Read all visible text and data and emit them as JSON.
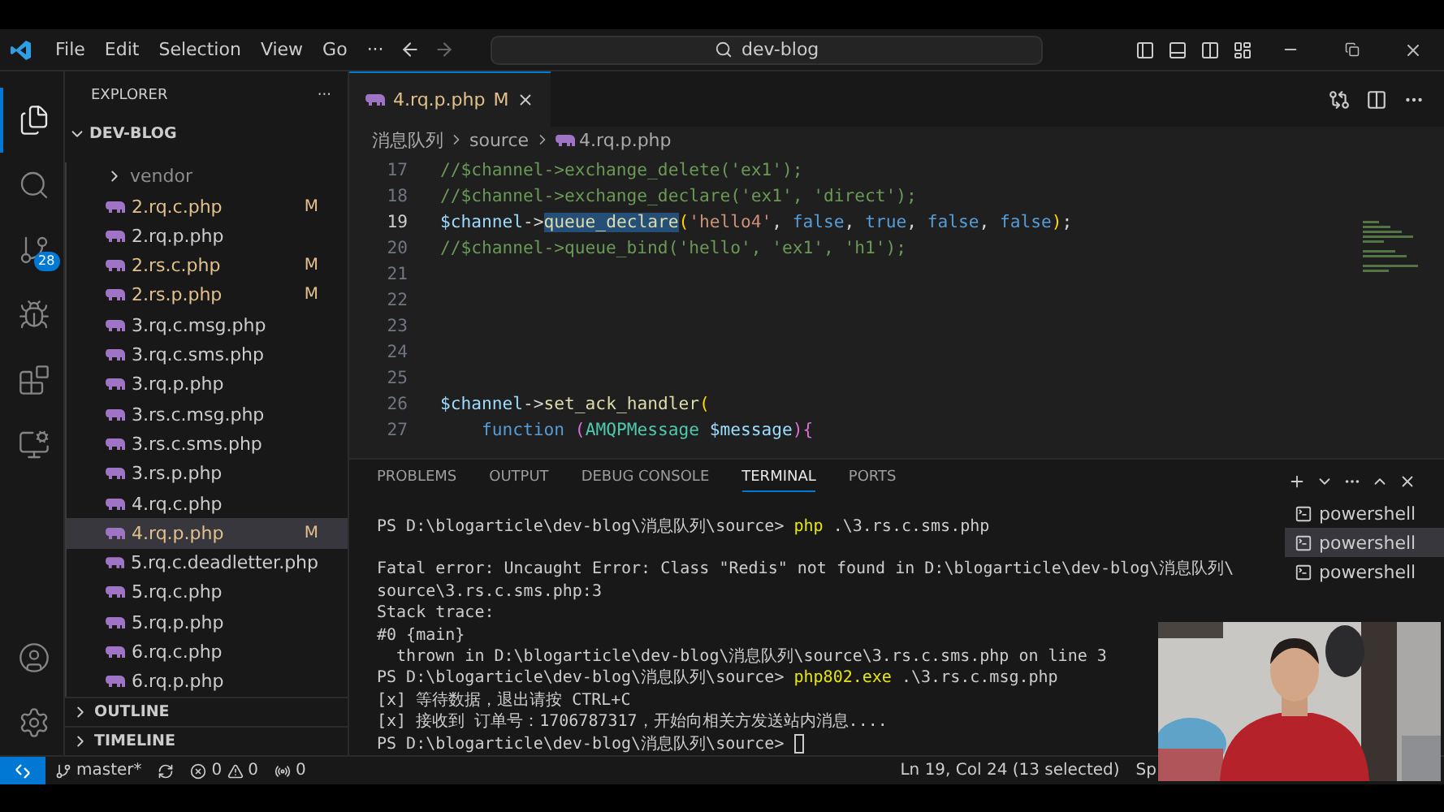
{
  "title_bar": {
    "menus": [
      "File",
      "Edit",
      "Selection",
      "View",
      "Go"
    ],
    "more": "···",
    "search": "dev-blog"
  },
  "activity_bar": {
    "items": [
      {
        "kind": "explorer",
        "selected": true
      },
      {
        "kind": "search",
        "selected": false
      },
      {
        "kind": "source-control",
        "selected": false,
        "badge": "28"
      },
      {
        "kind": "run",
        "selected": false
      },
      {
        "kind": "extensions",
        "selected": false
      },
      {
        "kind": "remote",
        "selected": false
      }
    ],
    "bottom": [
      {
        "kind": "account"
      },
      {
        "kind": "settings"
      }
    ]
  },
  "sidebar": {
    "title": "EXPLORER",
    "more": "···",
    "root": {
      "label": "DEV-BLOG",
      "expanded": true
    },
    "items": [
      {
        "kind": "folder",
        "name": "vendor",
        "expanded": false,
        "modified": false,
        "selected": false
      },
      {
        "kind": "file",
        "name": "2.rq.c.php",
        "modified": true,
        "badge": "M",
        "selected": false
      },
      {
        "kind": "file",
        "name": "2.rq.p.php",
        "modified": false,
        "selected": false
      },
      {
        "kind": "file",
        "name": "2.rs.c.php",
        "modified": true,
        "badge": "M",
        "selected": false
      },
      {
        "kind": "file",
        "name": "2.rs.p.php",
        "modified": true,
        "badge": "M",
        "selected": false
      },
      {
        "kind": "file",
        "name": "3.rq.c.msg.php",
        "modified": false,
        "selected": false
      },
      {
        "kind": "file",
        "name": "3.rq.c.sms.php",
        "modified": false,
        "selected": false
      },
      {
        "kind": "file",
        "name": "3.rq.p.php",
        "modified": false,
        "selected": false
      },
      {
        "kind": "file",
        "name": "3.rs.c.msg.php",
        "modified": false,
        "selected": false
      },
      {
        "kind": "file",
        "name": "3.rs.c.sms.php",
        "modified": false,
        "selected": false
      },
      {
        "kind": "file",
        "name": "3.rs.p.php",
        "modified": false,
        "selected": false
      },
      {
        "kind": "file",
        "name": "4.rq.c.php",
        "modified": false,
        "selected": false
      },
      {
        "kind": "file",
        "name": "4.rq.p.php",
        "modified": true,
        "badge": "M",
        "selected": true
      },
      {
        "kind": "file",
        "name": "5.rq.c.deadletter.php",
        "modified": false,
        "selected": false
      },
      {
        "kind": "file",
        "name": "5.rq.c.php",
        "modified": false,
        "selected": false
      },
      {
        "kind": "file",
        "name": "5.rq.p.php",
        "modified": false,
        "selected": false
      },
      {
        "kind": "file",
        "name": "6.rq.c.php",
        "modified": false,
        "selected": false
      },
      {
        "kind": "file",
        "name": "6.rq.p.php",
        "modified": false,
        "selected": false
      }
    ],
    "sections": [
      {
        "label": "OUTLINE",
        "expanded": false
      },
      {
        "label": "TIMELINE",
        "expanded": false
      }
    ]
  },
  "editor": {
    "tabs": [
      {
        "label": "4.rq.p.php",
        "badge": "M",
        "selected": true
      }
    ],
    "breadcrumb": [
      "消息队列",
      "source",
      "4.rq.p.php"
    ],
    "lines": [
      {
        "number": "17",
        "current": false,
        "tokens": [
          {
            "kind": "comment",
            "text": "//$channel->exchange_delete('ex1');",
            "selected": false
          }
        ]
      },
      {
        "number": "18",
        "current": false,
        "tokens": [
          {
            "kind": "comment",
            "text": "//$channel->exchange_declare('ex1', 'direct');",
            "selected": false
          }
        ]
      },
      {
        "number": "19",
        "current": true,
        "tokens": [
          {
            "kind": "variable",
            "text": "$channel",
            "selected": false
          },
          {
            "kind": "plain",
            "text": "->",
            "selected": false
          },
          {
            "kind": "method",
            "text": "queue_declare",
            "selected": true
          },
          {
            "kind": "bracket",
            "text": "(",
            "selected": false
          },
          {
            "kind": "string",
            "text": "'hello4'",
            "selected": false
          },
          {
            "kind": "plain",
            "text": ", ",
            "selected": false
          },
          {
            "kind": "keyword",
            "text": "false",
            "selected": false
          },
          {
            "kind": "plain",
            "text": ", ",
            "selected": false
          },
          {
            "kind": "keyword",
            "text": "true",
            "selected": false
          },
          {
            "kind": "plain",
            "text": ", ",
            "selected": false
          },
          {
            "kind": "keyword",
            "text": "false",
            "selected": false
          },
          {
            "kind": "plain",
            "text": ", ",
            "selected": false
          },
          {
            "kind": "keyword",
            "text": "false",
            "selected": false
          },
          {
            "kind": "bracket",
            "text": ")",
            "selected": false
          },
          {
            "kind": "plain",
            "text": ";",
            "selected": false
          }
        ]
      },
      {
        "number": "20",
        "current": false,
        "tokens": [
          {
            "kind": "comment",
            "text": "//$channel->queue_bind('hello', 'ex1', 'h1');",
            "selected": false
          }
        ]
      },
      {
        "number": "21",
        "current": false
      },
      {
        "number": "22",
        "current": false
      },
      {
        "number": "23",
        "current": false
      },
      {
        "number": "24",
        "current": false
      },
      {
        "number": "25",
        "current": false
      },
      {
        "number": "26",
        "current": false,
        "tokens": [
          {
            "kind": "variable",
            "text": "$channel",
            "selected": false
          },
          {
            "kind": "plain",
            "text": "->",
            "selected": false
          },
          {
            "kind": "method",
            "text": "set_ack_handler",
            "selected": false
          },
          {
            "kind": "bracket",
            "text": "(",
            "selected": false
          }
        ]
      },
      {
        "number": "27",
        "current": false,
        "tokens": [
          {
            "kind": "keyword",
            "text": "    function",
            "selected": false
          },
          {
            "kind": "bracket2",
            "text": " (",
            "selected": false
          },
          {
            "kind": "class",
            "text": "AMQPMessage",
            "selected": false
          },
          {
            "kind": "variable",
            "text": " $message",
            "selected": false
          },
          {
            "kind": "bracket2",
            "text": "){",
            "selected": false
          }
        ]
      }
    ]
  },
  "panel": {
    "tabs": [
      {
        "label": "PROBLEMS",
        "selected": false
      },
      {
        "label": "OUTPUT",
        "selected": false
      },
      {
        "label": "DEBUG CONSOLE",
        "selected": false
      },
      {
        "label": "TERMINAL",
        "selected": true
      },
      {
        "label": "PORTS",
        "selected": false
      }
    ],
    "terminal": {
      "cursor": true,
      "lines": [
        {
          "kind": "text",
          "segments": [
            {
              "kind": "plain",
              "text": "PS D:\\blogarticle\\dev-blog\\消息队列\\source> "
            },
            {
              "kind": "command",
              "text": "php"
            },
            {
              "kind": "plain",
              "text": " .\\3.rs.c.sms.php"
            }
          ]
        },
        {
          "kind": "blank"
        },
        {
          "kind": "text",
          "segments": [
            {
              "kind": "plain",
              "text": "Fatal error: Uncaught Error: Class \"Redis\" not found in D:\\blogarticle\\dev-blog\\消息队列\\"
            }
          ]
        },
        {
          "kind": "text",
          "segments": [
            {
              "kind": "plain",
              "text": "source\\3.rs.c.sms.php:3"
            }
          ]
        },
        {
          "kind": "text",
          "segments": [
            {
              "kind": "plain",
              "text": "Stack trace:"
            }
          ]
        },
        {
          "kind": "text",
          "segments": [
            {
              "kind": "plain",
              "text": "#0 {main}"
            }
          ]
        },
        {
          "kind": "text",
          "segments": [
            {
              "kind": "plain",
              "text": "  thrown in D:\\blogarticle\\dev-blog\\消息队列\\source\\3.rs.c.sms.php on line 3"
            }
          ]
        },
        {
          "kind": "text",
          "segments": [
            {
              "kind": "plain",
              "text": "PS D:\\blogarticle\\dev-blog\\消息队列\\source> "
            },
            {
              "kind": "command",
              "text": "php802.exe"
            },
            {
              "kind": "plain",
              "text": " .\\3.rs.c.msg.php"
            }
          ]
        },
        {
          "kind": "text",
          "segments": [
            {
              "kind": "plain",
              "text": "[x] 等待数据，退出请按 CTRL+C"
            }
          ]
        },
        {
          "kind": "text",
          "segments": [
            {
              "kind": "plain",
              "text": "[x] 接收到 订单号：1706787317，开始向相关方发送站内消息...."
            }
          ]
        },
        {
          "kind": "text",
          "segments": [
            {
              "kind": "plain",
              "text": "PS D:\\blogarticle\\dev-blog\\消息队列\\source> "
            }
          ]
        }
      ]
    },
    "terminals": [
      {
        "label": "powershell",
        "selected": false
      },
      {
        "label": "powershell",
        "selected": true
      },
      {
        "label": "powershell",
        "selected": false
      }
    ]
  },
  "status_bar": {
    "branch": "master*",
    "errors": "0",
    "warnings": "0",
    "ports": "0",
    "position": "Ln 19, Col 24 (13 selected)",
    "indent": "Sp"
  }
}
